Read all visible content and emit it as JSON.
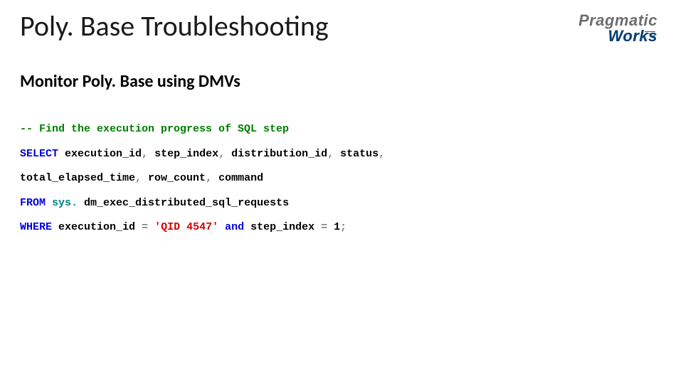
{
  "title": "Poly. Base Troubleshooting",
  "logo": {
    "top": "Pragmatic",
    "bottom": "Works"
  },
  "subtitle": "Monitor Poly. Base using DMVs",
  "code": {
    "l1_comment": "-- Find the execution progress of SQL step",
    "l2_select": "SELECT",
    "l2_a": " execution_id",
    "l2_b": " step_index",
    "l2_c": " distribution_id",
    "l2_d": " status",
    "comma": ",",
    "l3": "total_elapsed_time",
    "l3_b": " row_count",
    "l3_c": " command",
    "l4_from": "FROM",
    "l4_sys": " sys.",
    "l4_tbl": " dm_exec_distributed_sql_requests",
    "l5_where": "WHERE",
    "l5_a": " execution_id ",
    "l5_eq": "=",
    "l5_str": " 'QID 4547' ",
    "l5_and": "and",
    "l5_b": " step_index ",
    "l5_num": " 1",
    "l5_semi": ";"
  }
}
